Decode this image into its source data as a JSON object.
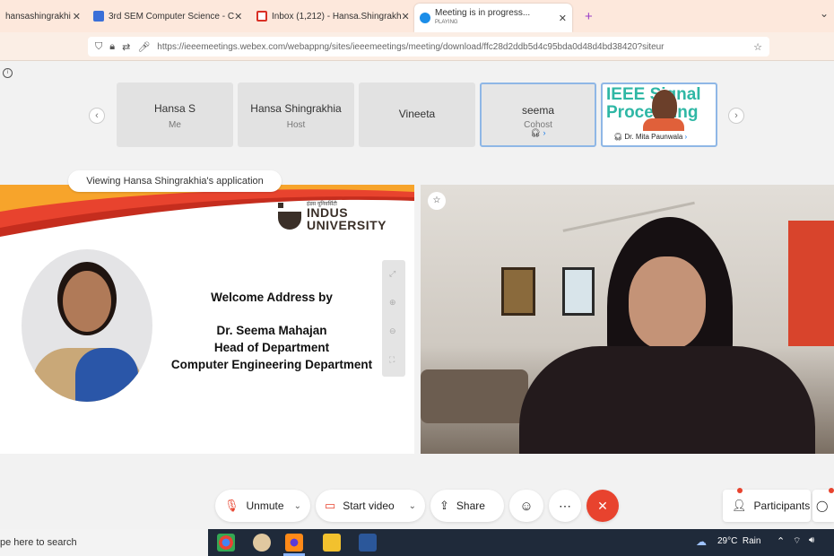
{
  "browser": {
    "tabs": [
      {
        "label": "hansashingrakhi",
        "active": false
      },
      {
        "label": "3rd SEM Computer Science - C",
        "active": false
      },
      {
        "label": "Inbox (1,212) - Hansa.Shingrakh",
        "active": false
      },
      {
        "label": "Meeting is in progress...",
        "sub": "PLAYING",
        "active": true
      }
    ],
    "new_tab": "+",
    "close": "✕",
    "url": "https://ieeemeetings.webex.com/webappng/sites/ieeemeetings/meeting/download/ffc28d2ddb5d4c95bda0d48d4bd38420?siteur"
  },
  "participants": [
    {
      "name": "Hansa S",
      "role": "Me"
    },
    {
      "name": "Hansa Shingrakhia",
      "role": "Host"
    },
    {
      "name": "Vineeta",
      "role": ""
    },
    {
      "name": "seema",
      "role": "Cohost"
    },
    {
      "name": "Dr. Mita Paunwala",
      "role": "",
      "overlay": "IEEE Signal Processing"
    }
  ],
  "viewing_label": "Viewing Hansa Shingrakhia's application",
  "slide": {
    "logo_small": "इंडस यूनिवर्सिटी",
    "logo_line1": "INDUS",
    "logo_line2": "UNIVERSITY",
    "line1": "Welcome Address by",
    "line2": "Dr. Seema Mahajan",
    "line3": "Head of Department",
    "line4": "Computer Engineering Department"
  },
  "controls": {
    "unmute": "Unmute",
    "start_video": "Start video",
    "share": "Share",
    "participants": "Participants"
  },
  "taskbar": {
    "search": "pe here to search",
    "weather": "29°C  Rain"
  },
  "colors": {
    "accent": "#e8432e",
    "tab_bg": "#fde8dc",
    "taskbar": "#1f2a3a"
  }
}
